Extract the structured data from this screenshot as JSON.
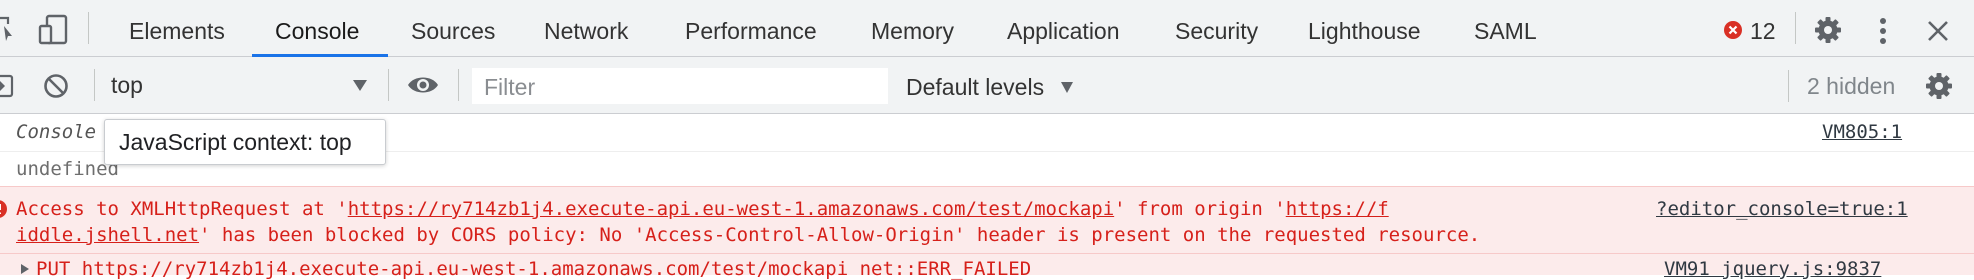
{
  "tabs": {
    "elements": "Elements",
    "console": "Console",
    "sources": "Sources",
    "network": "Network",
    "performance": "Performance",
    "memory": "Memory",
    "application": "Application",
    "security": "Security",
    "lighthouse": "Lighthouse",
    "saml": "SAML"
  },
  "error_count": "12",
  "toolbar": {
    "context": "top",
    "filter_placeholder": "Filter",
    "levels": "Default levels",
    "hidden": "2 hidden"
  },
  "tooltip": "JavaScript context: top",
  "console": {
    "line1": "Console",
    "line1_source": "VM805:1",
    "line2": "undefined",
    "error1_prefix": "Access to XMLHttpRequest at '",
    "error1_url": "https://ry714zb1j4.execute-api.eu-west-1.amazonaws.com/test/mockapi",
    "error1_mid": "' from origin '",
    "error1_origin_a": "https://f",
    "error1_source": "?editor_console=true:1",
    "error1_origin_b": "iddle.jshell.net",
    "error1_suffix": "' has been blocked by CORS policy: No 'Access-Control-Allow-Origin' header is present on the requested resource.",
    "error2_text": "PUT https://ry714zb1j4.execute-api.eu-west-1.amazonaws.com/test/mockapi net::ERR_FAILED",
    "error2_source": "VM91 jquery.js:9837"
  },
  "colors": {
    "accent": "#1a73e8",
    "error": "#d6201a",
    "error_bg": "#fcebeb"
  }
}
